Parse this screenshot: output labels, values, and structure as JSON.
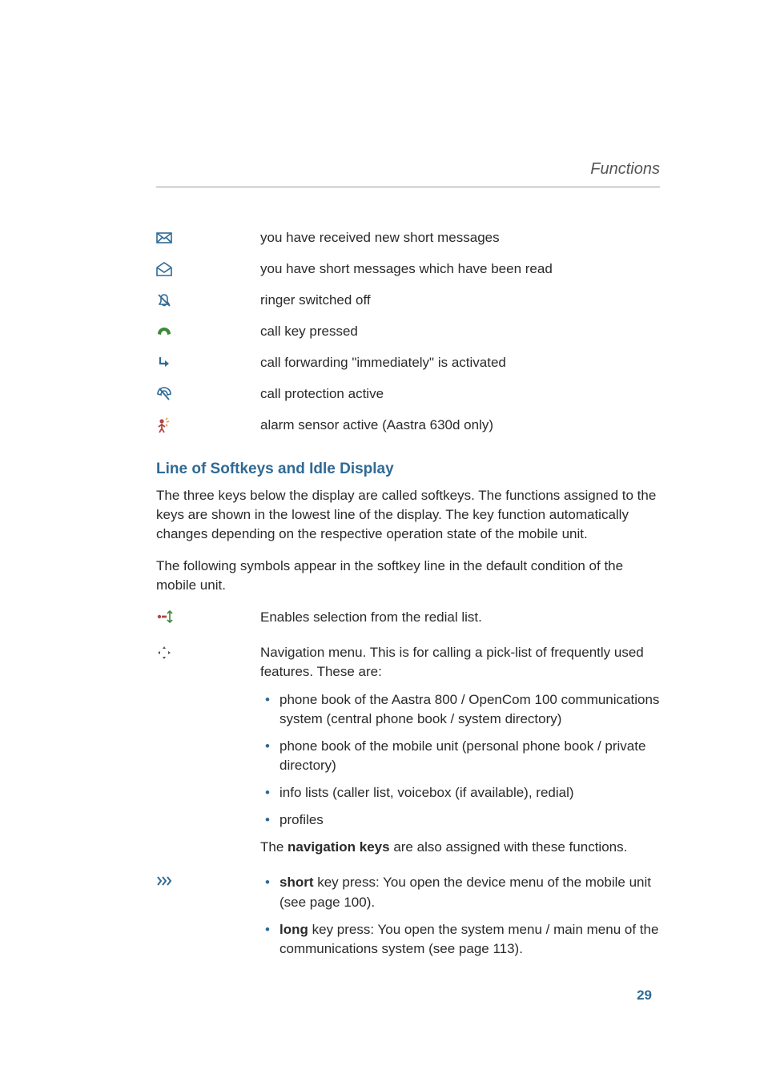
{
  "header": {
    "title": "Functions"
  },
  "icon_rows": [
    {
      "desc": "you have received new short messages"
    },
    {
      "desc": "you have short messages which have been read"
    },
    {
      "desc": "ringer switched off"
    },
    {
      "desc": "call key pressed"
    },
    {
      "desc": "call forwarding \"immediately\" is activated"
    },
    {
      "desc": "call protection active"
    },
    {
      "desc": "alarm sensor active (Aastra 630d only)"
    }
  ],
  "section": {
    "heading": "Line of Softkeys and Idle Display"
  },
  "paragraphs": {
    "p1": "The three keys below the display are called softkeys. The functions assigned to the keys are shown in the lowest line of the display. The key function automatically changes depending on the respective operation state of the mobile unit.",
    "p2": "The following symbols appear in the softkey line in the default condition of the mobile unit."
  },
  "softkeys": {
    "row1": {
      "text": "Enables selection from the redial list."
    },
    "row2": {
      "intro": "Navigation menu. This is for calling a pick-list of frequently used features. These are:",
      "bullets": [
        "phone book of the Aastra 800 / OpenCom 100 communications system (central phone book / system directory)",
        "phone book of the mobile unit (personal phone book / private directory)",
        "info lists (caller list, voicebox (if available), redial)",
        "profiles"
      ],
      "outro_pre": "The ",
      "outro_bold": "navigation keys",
      "outro_post": " are also assigned with these functions."
    },
    "row3": {
      "bullets": [
        {
          "bold": "short",
          "rest": " key press: You open the device menu of the mobile unit (see page 100)."
        },
        {
          "bold": "long",
          "rest": " key press: You open the system menu / main menu of the communications system (see page 113)."
        }
      ]
    }
  },
  "page_number": "29"
}
